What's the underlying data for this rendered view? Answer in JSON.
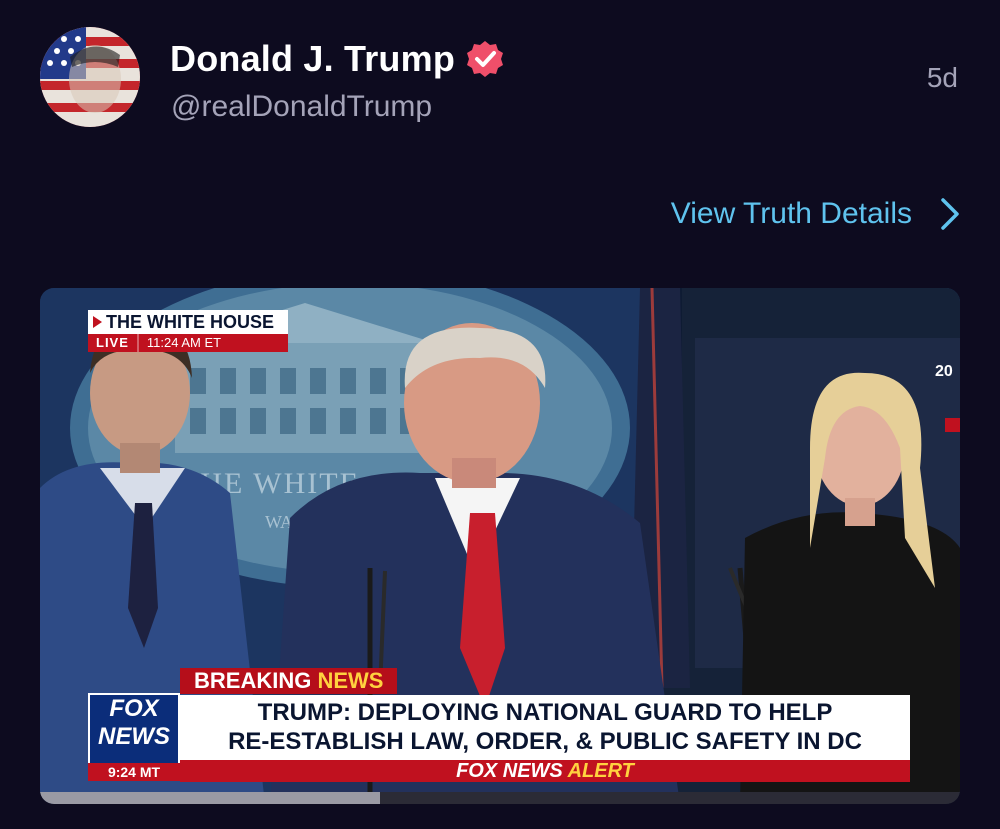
{
  "post": {
    "display_name": "Donald J. Trump",
    "handle": "@realDonaldTrump",
    "timestamp": "5d",
    "verified": true,
    "details_link": "View Truth Details"
  },
  "media": {
    "bug_title": "THE WHITE HOUSE",
    "bug_live": "LIVE",
    "bug_time": "11:24 AM ET",
    "breaking_label": "BREAKING",
    "breaking_news_word": "NEWS",
    "headline_line1": "TRUMP: DEPLOYING NATIONAL GUARD TO HELP",
    "headline_line2": "RE-ESTABLISH LAW, ORDER, & PUBLIC SAFETY IN DC",
    "alert_brand": "FOX NEWS",
    "alert_word": "ALERT",
    "network_logo_line1": "FOX",
    "network_logo_line2": "NEWS",
    "network_time": "9:24 MT",
    "backdrop_text": "THE WHITE",
    "backdrop_subtext": "WAS",
    "screen_number": "20",
    "progress_fraction": 0.37
  },
  "colors": {
    "background": "#0d0b1f",
    "link": "#5fc3ee",
    "verified_badge": "#ef4f6a",
    "muted_text": "#a4a3b8"
  }
}
